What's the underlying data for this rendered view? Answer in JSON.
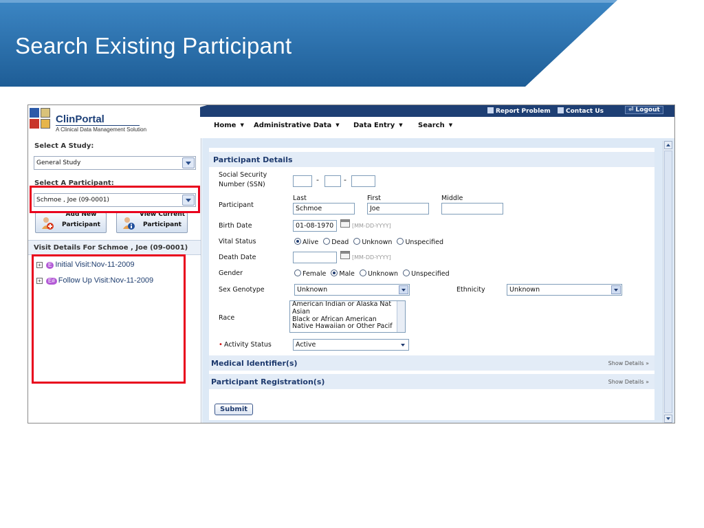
{
  "slide": {
    "title": "Search Existing Participant"
  },
  "app": {
    "logo": {
      "name": "ClinPortal",
      "tagline": "A Clinical Data Management Solution"
    },
    "top_links": {
      "report": "Report Problem",
      "contact": "Contact Us",
      "logout": "Logout"
    },
    "menu": {
      "home": "Home",
      "admin": "Administrative Data",
      "data_entry": "Data Entry",
      "search": "Search"
    }
  },
  "left": {
    "study_label": "Select A Study:",
    "study_value": "General Study",
    "participant_label": "Select A Participant:",
    "participant_value": "Schmoe , Joe (09-0001)",
    "add_btn": {
      "line1": "Add New",
      "line2": "Participant"
    },
    "view_btn": {
      "line1": "View Current",
      "line2": "Participant"
    },
    "visit_header": "Visit Details For  Schmoe , Joe (09-0001)",
    "visits": [
      {
        "badge": "E",
        "label": "Initial Visit:Nov-11-2009"
      },
      {
        "badge": "E#",
        "label": "Follow Up Visit:Nov-11-2009"
      }
    ]
  },
  "form": {
    "section_title": "Participant Details",
    "ssn_label_1": "Social Security",
    "ssn_label_2": "Number (SSN)",
    "participant_label": "Participant",
    "last_label": "Last",
    "first_label": "First",
    "middle_label": "Middle",
    "last_value": "Schmoe",
    "first_value": "Joe",
    "middle_value": "",
    "birth_label": "Birth Date",
    "birth_value": "01-08-1970",
    "date_hint": "[MM-DD-YYYY]",
    "vital_label": "Vital Status",
    "vital_options": [
      "Alive",
      "Dead",
      "Unknown",
      "Unspecified"
    ],
    "death_label": "Death Date",
    "gender_label": "Gender",
    "gender_options": [
      "Female",
      "Male",
      "Unknown",
      "Unspecified"
    ],
    "sex_label": "Sex Genotype",
    "sex_value": "Unknown",
    "ethnicity_label": "Ethnicity",
    "ethnicity_value": "Unknown",
    "race_label": "Race",
    "race_options": [
      "American Indian or Alaska Nat",
      "Asian",
      "Black or African American",
      "Native Hawaiian or Other Pacif"
    ],
    "activity_label": "Activity Status",
    "activity_value": "Active",
    "medical_title": "Medical Identifier(s)",
    "registration_title": "Participant Registration(s)",
    "show_details": "Show Details",
    "submit": "Submit"
  }
}
